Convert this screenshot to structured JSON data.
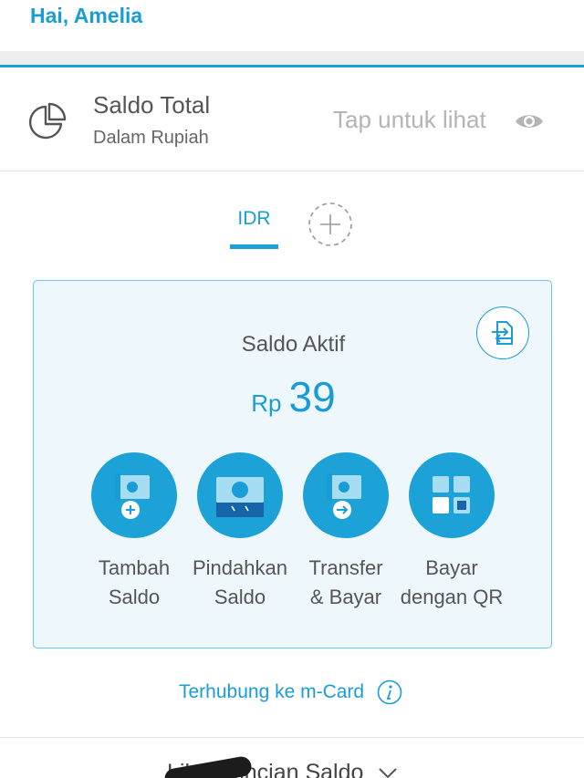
{
  "header": {
    "greeting": "Hai, Amelia"
  },
  "saldo_total": {
    "title": "Saldo Total",
    "subtitle": "Dalam Rupiah",
    "tap_to_view": "Tap untuk lihat",
    "icon": "pie-chart-icon",
    "eye_icon": "eye-icon"
  },
  "currency_tabs": {
    "active": "IDR",
    "add_icon": "plus-icon"
  },
  "card": {
    "title": "Saldo Aktif",
    "currency": "Rp",
    "amount": "39",
    "actions": [
      {
        "label": "Tambah\nSaldo",
        "icon": "money-plus-icon"
      },
      {
        "label": "Pindahkan\nSaldo",
        "icon": "money-move-icon"
      },
      {
        "label": "Transfer\n& Bayar",
        "icon": "money-transfer-icon"
      },
      {
        "label": "Bayar\ndengan QR",
        "icon": "qr-grid-icon"
      }
    ]
  },
  "mcard": {
    "label": "Terhubung ke m-Card",
    "icon": "info-icon"
  },
  "detail": {
    "label": "Lihat Rincian Saldo",
    "icon": "chevron-down-icon"
  },
  "colors": {
    "accent": "#1DA2D8",
    "card_bg": "#EEF7FC",
    "text": "#555555",
    "muted": "#B4B4B4"
  }
}
